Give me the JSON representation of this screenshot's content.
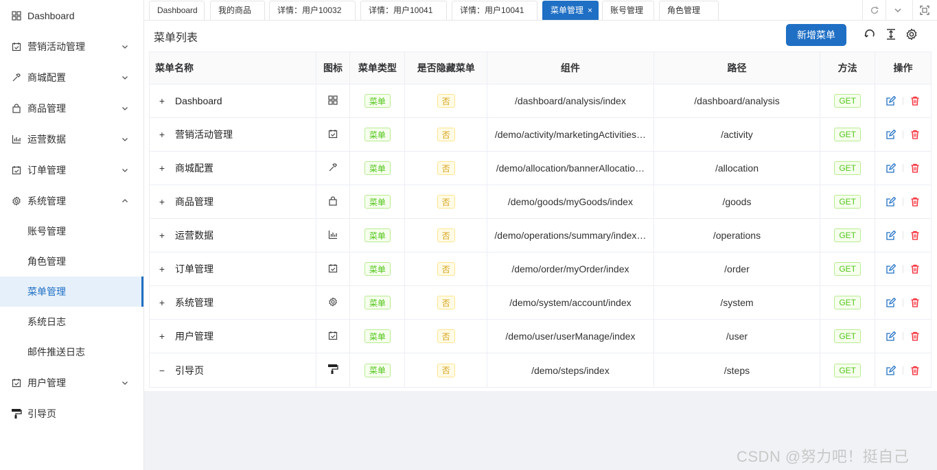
{
  "sidebar": {
    "items": [
      {
        "label": "Dashboard",
        "icon": "grid-icon",
        "chevron": "none"
      },
      {
        "label": "营销活动管理",
        "icon": "calendar-check-icon",
        "chevron": "down"
      },
      {
        "label": "商城配置",
        "icon": "hammer-icon",
        "chevron": "down"
      },
      {
        "label": "商品管理",
        "icon": "bag-icon",
        "chevron": "down"
      },
      {
        "label": "运营数据",
        "icon": "bar-chart-icon",
        "chevron": "down"
      },
      {
        "label": "订单管理",
        "icon": "calendar-check-icon",
        "chevron": "down"
      },
      {
        "label": "系统管理",
        "icon": "gear-icon",
        "chevron": "up"
      }
    ],
    "system_children": [
      "账号管理",
      "角色管理",
      "菜单管理",
      "系统日志",
      "邮件推送日志"
    ],
    "active_child": "菜单管理",
    "after_items": [
      {
        "label": "用户管理",
        "icon": "calendar-check-icon",
        "chevron": "down"
      },
      {
        "label": "引导页",
        "icon": "paint-roller-icon",
        "chevron": "none"
      }
    ]
  },
  "tabs": [
    {
      "label": "Dashboard",
      "active": false
    },
    {
      "label": "我的商品",
      "active": false
    },
    {
      "label": "详情：用户10032",
      "active": false
    },
    {
      "label": "详情：用户10041",
      "active": false
    },
    {
      "label": "详情：用户10041",
      "active": false
    },
    {
      "label": "菜单管理",
      "active": true,
      "close": "×"
    },
    {
      "label": "账号管理",
      "active": false
    },
    {
      "label": "角色管理",
      "active": false
    }
  ],
  "page": {
    "title": "菜单列表",
    "add_button": "新增菜单"
  },
  "table": {
    "headers": {
      "name": "菜单名称",
      "icon": "图标",
      "type": "菜单类型",
      "hidden": "是否隐藏菜单",
      "component": "组件",
      "path": "路径",
      "method": "方法",
      "actions": "操作"
    },
    "rows": [
      {
        "expander": "+",
        "name": "Dashboard",
        "icon": "grid-icon",
        "type": "菜单",
        "hidden": "否",
        "component": "/dashboard/analysis/index",
        "path": "/dashboard/analysis",
        "method": "GET"
      },
      {
        "expander": "+",
        "name": "营销活动管理",
        "icon": "calendar-check-icon",
        "type": "菜单",
        "hidden": "否",
        "component": "/demo/activity/marketingActivities…",
        "path": "/activity",
        "method": "GET"
      },
      {
        "expander": "+",
        "name": "商城配置",
        "icon": "hammer-icon",
        "type": "菜单",
        "hidden": "否",
        "component": "/demo/allocation/bannerAllocatio…",
        "path": "/allocation",
        "method": "GET"
      },
      {
        "expander": "+",
        "name": "商品管理",
        "icon": "bag-icon",
        "type": "菜单",
        "hidden": "否",
        "component": "/demo/goods/myGoods/index",
        "path": "/goods",
        "method": "GET"
      },
      {
        "expander": "+",
        "name": "运营数据",
        "icon": "bar-chart-icon",
        "type": "菜单",
        "hidden": "否",
        "component": "/demo/operations/summary/index…",
        "path": "/operations",
        "method": "GET"
      },
      {
        "expander": "+",
        "name": "订单管理",
        "icon": "calendar-check-icon",
        "type": "菜单",
        "hidden": "否",
        "component": "/demo/order/myOrder/index",
        "path": "/order",
        "method": "GET"
      },
      {
        "expander": "+",
        "name": "系统管理",
        "icon": "gear-icon",
        "type": "菜单",
        "hidden": "否",
        "component": "/demo/system/account/index",
        "path": "/system",
        "method": "GET"
      },
      {
        "expander": "+",
        "name": "用户管理",
        "icon": "calendar-check-icon",
        "type": "菜单",
        "hidden": "否",
        "component": "/demo/user/userManage/index",
        "path": "/user",
        "method": "GET"
      },
      {
        "expander": "−",
        "name": "引导页",
        "icon": "paint-roller-icon",
        "type": "菜单",
        "hidden": "否",
        "component": "/demo/steps/index",
        "path": "/steps",
        "method": "GET"
      }
    ]
  },
  "watermark": "CSDN @努力吧！挺自己",
  "colors": {
    "primary": "#1f6fc4",
    "tag_green": "#52c41a",
    "tag_yellow": "#d4a017",
    "edit": "#1f6fc4",
    "delete": "#f5222d"
  }
}
